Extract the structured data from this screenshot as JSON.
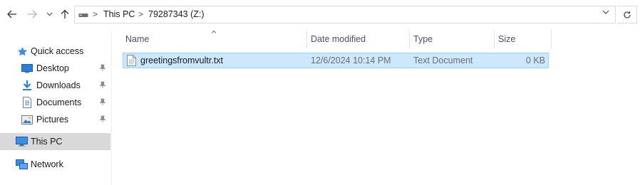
{
  "address_bar": {
    "breadcrumbs": [
      "This PC",
      "79287343 (Z:)"
    ],
    "separator": ">"
  },
  "toolbar": {
    "back_icon": "arrow-left-icon",
    "forward_icon": "arrow-right-icon",
    "recent_icon": "chevron-down-icon",
    "up_icon": "arrow-up-icon",
    "refresh_icon": "refresh-icon"
  },
  "sidebar": {
    "items": [
      {
        "label": "Quick access",
        "icon": "star-icon",
        "pinned": false
      },
      {
        "label": "Desktop",
        "icon": "desktop-icon",
        "pinned": true
      },
      {
        "label": "Downloads",
        "icon": "download-icon",
        "pinned": true
      },
      {
        "label": "Documents",
        "icon": "document-icon",
        "pinned": true
      },
      {
        "label": "Pictures",
        "icon": "pictures-icon",
        "pinned": true
      },
      {
        "label": "This PC",
        "icon": "computer-icon",
        "pinned": false,
        "selected": true
      },
      {
        "label": "Network",
        "icon": "network-icon",
        "pinned": false
      }
    ]
  },
  "file_list": {
    "columns": [
      "Name",
      "Date modified",
      "Type",
      "Size"
    ],
    "rows": [
      {
        "name": "greetingsfromvultr.txt",
        "date_modified": "12/6/2024 10:14 PM",
        "type": "Text Document",
        "size": "0 KB",
        "selected": true
      }
    ]
  },
  "colors": {
    "selection_bg": "#cce8ff",
    "selection_border": "#99d1ff",
    "sidebar_selected": "#d9d9d9",
    "accent_blue": "#0078d7"
  }
}
